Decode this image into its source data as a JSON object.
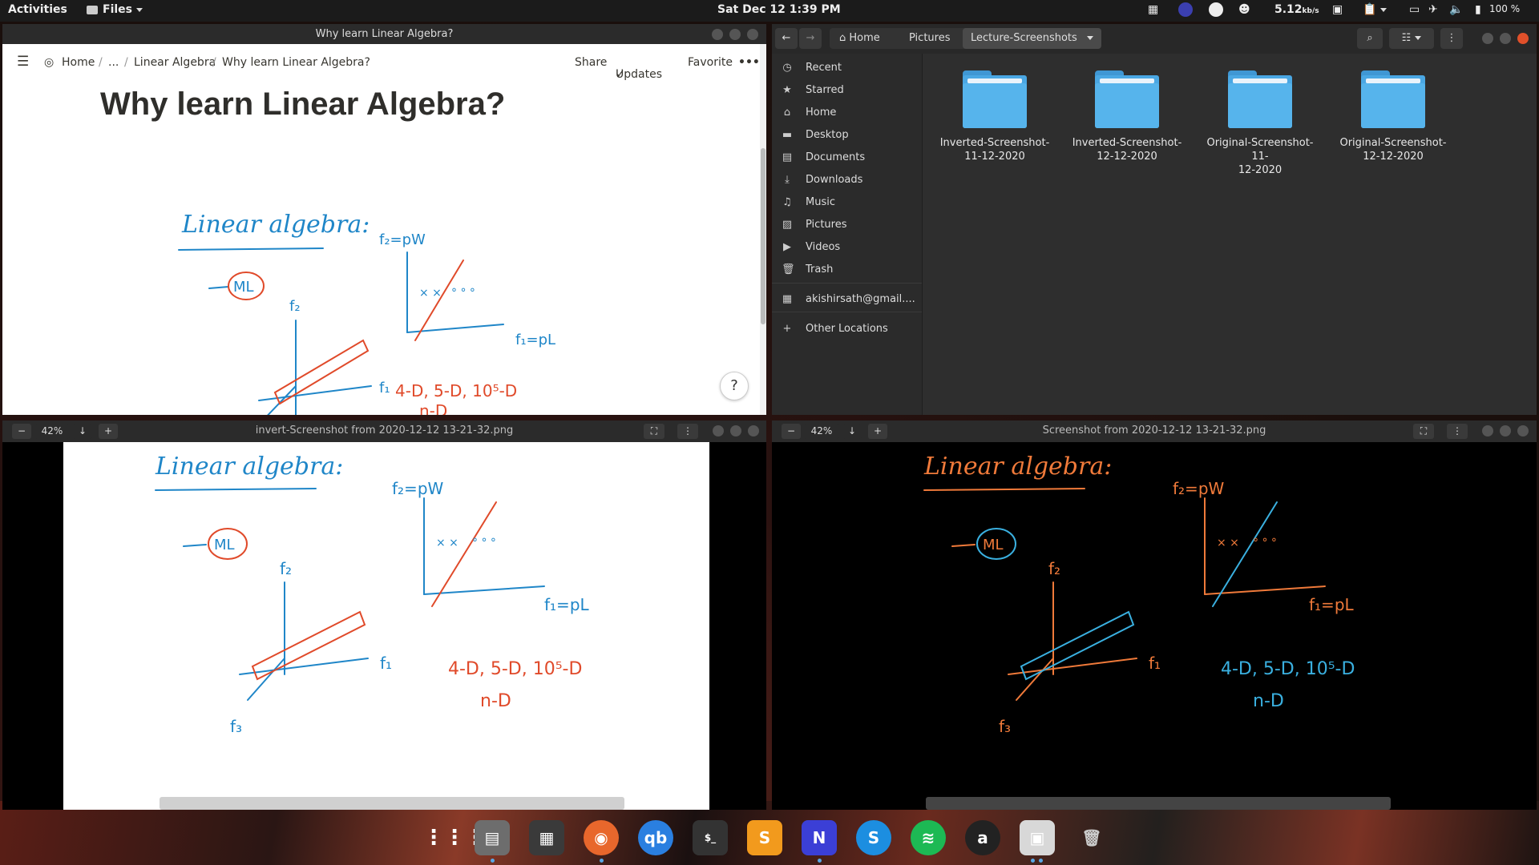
{
  "topbar": {
    "activities": "Activities",
    "app_menu": "Files",
    "clock": "Sat Dec 12  1:39 PM",
    "net_speed": "5.12",
    "net_unit": "kb/s",
    "battery": "100 %"
  },
  "notion": {
    "window_title": "Why learn Linear Algebra?",
    "breadcrumb": [
      "Home",
      "...",
      "Linear Algebra",
      "Why learn Linear Algebra?"
    ],
    "share": "Share",
    "updates": "Updates",
    "favorite": "Favorite",
    "more": "•••",
    "page_title": "Why learn Linear Algebra?",
    "help": "?"
  },
  "files": {
    "path": [
      "Home",
      "Pictures",
      "Lecture-Screenshots"
    ],
    "sidebar": [
      {
        "label": "Recent",
        "icon": "clock-icon"
      },
      {
        "label": "Starred",
        "icon": "star-icon"
      },
      {
        "label": "Home",
        "icon": "home-icon"
      },
      {
        "label": "Desktop",
        "icon": "desktop-icon"
      },
      {
        "label": "Documents",
        "icon": "document-icon"
      },
      {
        "label": "Downloads",
        "icon": "download-icon"
      },
      {
        "label": "Music",
        "icon": "music-icon"
      },
      {
        "label": "Pictures",
        "icon": "picture-icon"
      },
      {
        "label": "Videos",
        "icon": "video-icon"
      },
      {
        "label": "Trash",
        "icon": "trash-icon"
      }
    ],
    "account": "akishirsath@gmail....",
    "other_locations": "Other Locations",
    "folders": [
      {
        "line1": "Inverted-Screenshot-",
        "line2": "11-12-2020"
      },
      {
        "line1": "Inverted-Screenshot-",
        "line2": "12-12-2020"
      },
      {
        "line1": "Original-Screenshot-11-",
        "line2": "12-2020"
      },
      {
        "line1": "Original-Screenshot-",
        "line2": "12-12-2020"
      }
    ]
  },
  "viewer_left": {
    "zoom": "42%",
    "title": "invert-Screenshot from 2020-12-12 13-21-32.png"
  },
  "viewer_right": {
    "zoom": "42%",
    "title": "Screenshot from 2020-12-12 13-21-32.png"
  },
  "handwriting": {
    "heading": "Linear algebra:",
    "ml": "ML",
    "f2": "f₂",
    "f1": "f₁",
    "f3": "f₃",
    "f2_pw": "f₂=pW",
    "f1_pl": "f₁=pL",
    "dims": "4-D, 5-D, 10⁵-D",
    "nd": "n-D"
  },
  "colors": {
    "blue_ink": "#1f86c8",
    "red_ink": "#e04a2a",
    "orange_ink": "#f07a3a",
    "cyan_ink": "#3ab0e0"
  }
}
